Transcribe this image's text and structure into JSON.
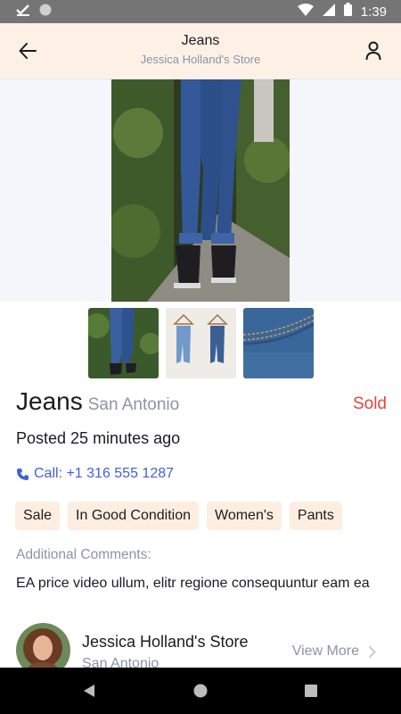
{
  "status_bar": {
    "time": "1:39"
  },
  "app_bar": {
    "title": "Jeans",
    "subtitle": "Jessica Holland's Store"
  },
  "listing": {
    "title": "Jeans",
    "location": "San Antonio",
    "status": "Sold",
    "posted": "Posted 25 minutes ago",
    "call_label": "Call: +1 316 555 1287",
    "tags": [
      "Sale",
      "In Good Condition",
      "Women's",
      "Pants"
    ],
    "comments_label": "Additional Comments:",
    "comments": "EA price video ullum, elitr regione consequuntur eam ea"
  },
  "store": {
    "name": "Jessica Holland's Store",
    "location": "San Antonio",
    "view_more": "View More"
  },
  "colors": {
    "app_bar_bg": "#fdf1e6",
    "tag_bg": "#fdeee1",
    "sold_red": "#e8453c",
    "link_blue": "#3f63d6",
    "muted_gray": "#8a94a8"
  }
}
